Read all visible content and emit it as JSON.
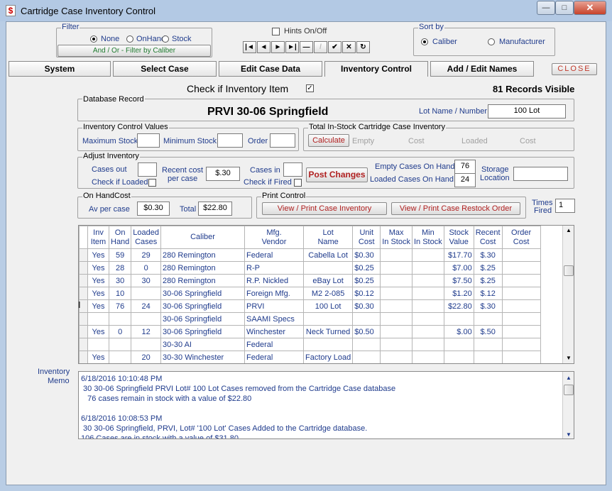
{
  "window": {
    "title": "Cartridge Case Inventory Control",
    "minimize": "—",
    "maximize": "□",
    "close": "✕"
  },
  "filter": {
    "caption": "Filter",
    "options": [
      "None",
      "OnHand",
      "Stock"
    ],
    "selected": "None",
    "button": "And / Or - Filter by Caliber"
  },
  "hints": {
    "label": "Hints On/Off",
    "checked": false
  },
  "nav": {
    "buttons": [
      "|◄",
      "◄",
      "►",
      "►|",
      "—",
      "/",
      "✔",
      "✕",
      "↻"
    ]
  },
  "sort": {
    "caption": "Sort by",
    "options": [
      "Caliber",
      "Manufacturer"
    ],
    "selected": "Caliber"
  },
  "tabs": [
    "System",
    "Select Case",
    "Edit Case Data",
    "Inventory Control",
    "Add / Edit Names"
  ],
  "active_tab": "Inventory Control",
  "close_label": "CLOSE",
  "check_inventory": {
    "label": "Check if Inventory Item",
    "checked": true
  },
  "records_visible": "81 Records Visible",
  "db_record": {
    "caption": "Database Record",
    "name": "PRVI  30-06 Springfield",
    "lot_label": "Lot Name / Number",
    "lot_value": "100 Lot"
  },
  "icv": {
    "caption": "Inventory Control Values",
    "max_label": "Maximum Stock",
    "max_value": "",
    "min_label": "Minimum Stock",
    "min_value": "",
    "order_label": "Order",
    "order_value": ""
  },
  "total": {
    "caption": "Total  In-Stock Cartridge Case Inventory",
    "calc": "Calculate",
    "empty": "Empty",
    "cost1": "Cost",
    "loaded": "Loaded",
    "cost2": "Cost"
  },
  "adjust": {
    "caption": "Adjust Inventory",
    "cases_out": "Cases out",
    "check_loaded": "Check if Loaded",
    "recent_cost_l1": "Recent cost",
    "recent_cost_l2": "per case",
    "recent_cost_value": "$.30",
    "cases_in": "Cases in",
    "check_fired": "Check if Fired",
    "post": "Post Changes",
    "empty_label": "Empty Cases On Hand",
    "empty_value": "76",
    "loaded_label": "Loaded Cases On Hand",
    "loaded_value": "24",
    "storage_l1": "Storage",
    "storage_l2": "Location",
    "storage_value": ""
  },
  "onhand": {
    "caption": "On HandCost",
    "av_label": "Av per case",
    "av_value": "$0.30",
    "total_label": "Total",
    "total_value": "$22.80"
  },
  "print": {
    "caption": "Print Control",
    "inv_btn": "View / Print Case Inventory",
    "restock_btn": "View / Print Case Restock Order"
  },
  "times_fired": {
    "label1": "Times",
    "label2": "Fired",
    "value": "1"
  },
  "table": {
    "headers": [
      [
        "Inv",
        "Item"
      ],
      [
        "On",
        "Hand"
      ],
      [
        "Loaded",
        "Cases"
      ],
      [
        "Caliber",
        ""
      ],
      [
        "Mfg.",
        "Vendor"
      ],
      [
        "Lot",
        "Name"
      ],
      [
        "Unit",
        "Cost"
      ],
      [
        "Max",
        "In Stock"
      ],
      [
        "Min",
        "In Stock"
      ],
      [
        "Stock",
        "Value"
      ],
      [
        "Recent",
        "Cost"
      ],
      [
        "Order",
        "Cost"
      ]
    ],
    "rows": [
      [
        "Yes",
        "59",
        "29",
        "280 Remington",
        "Federal",
        "Cabella Lot",
        "$0.30",
        "",
        "",
        "$17.70",
        "$.30",
        ""
      ],
      [
        "Yes",
        "28",
        "0",
        "280 Remington",
        "R-P",
        "",
        "$0.25",
        "",
        "",
        "$7.00",
        "$.25",
        ""
      ],
      [
        "Yes",
        "30",
        "30",
        "280 Remington",
        "R.P. Nickled",
        "eBay Lot",
        "$0.25",
        "",
        "",
        "$7.50",
        "$.25",
        ""
      ],
      [
        "Yes",
        "10",
        "",
        "30-06 Springfield",
        "Foreign Mfg.",
        "M2 2-085",
        "$0.12",
        "",
        "",
        "$1.20",
        "$.12",
        ""
      ],
      [
        "Yes",
        "76",
        "24",
        "30-06 Springfield",
        "PRVI",
        "100 Lot",
        "$0.30",
        "",
        "",
        "$22.80",
        "$.30",
        ""
      ],
      [
        "",
        "",
        "",
        "30-06 Springfield",
        "SAAMI Specs",
        "",
        "",
        "",
        "",
        "",
        "",
        ""
      ],
      [
        "Yes",
        "0",
        "12",
        "30-06 Springfield",
        "Winchester",
        "Neck Turned",
        "$0.50",
        "",
        "",
        "$.00",
        "$.50",
        ""
      ],
      [
        "",
        "",
        "",
        "30-30 AI",
        "Federal",
        "",
        "",
        "",
        "",
        "",
        "",
        ""
      ],
      [
        "Yes",
        "",
        "20",
        "30-30 Winchester",
        "Federal",
        "Factory Load",
        "",
        "",
        "",
        "",
        "",
        ""
      ]
    ]
  },
  "memo": {
    "label1": "Inventory",
    "label2": "Memo",
    "lines": [
      "6/18/2016 10:10:48 PM",
      " 30 30-06 Springfield PRVI Lot# 100 Lot Cases removed from the Cartridge Case database",
      "   76 cases remain in stock with a value of $22.80",
      "",
      "6/18/2016 10:08:53 PM",
      " 30 30-06 Springfield, PRVI, Lot# '100 Lot' Cases Added to the Cartridge database.",
      "106 Cases are in stock with a value of $31.80"
    ]
  }
}
